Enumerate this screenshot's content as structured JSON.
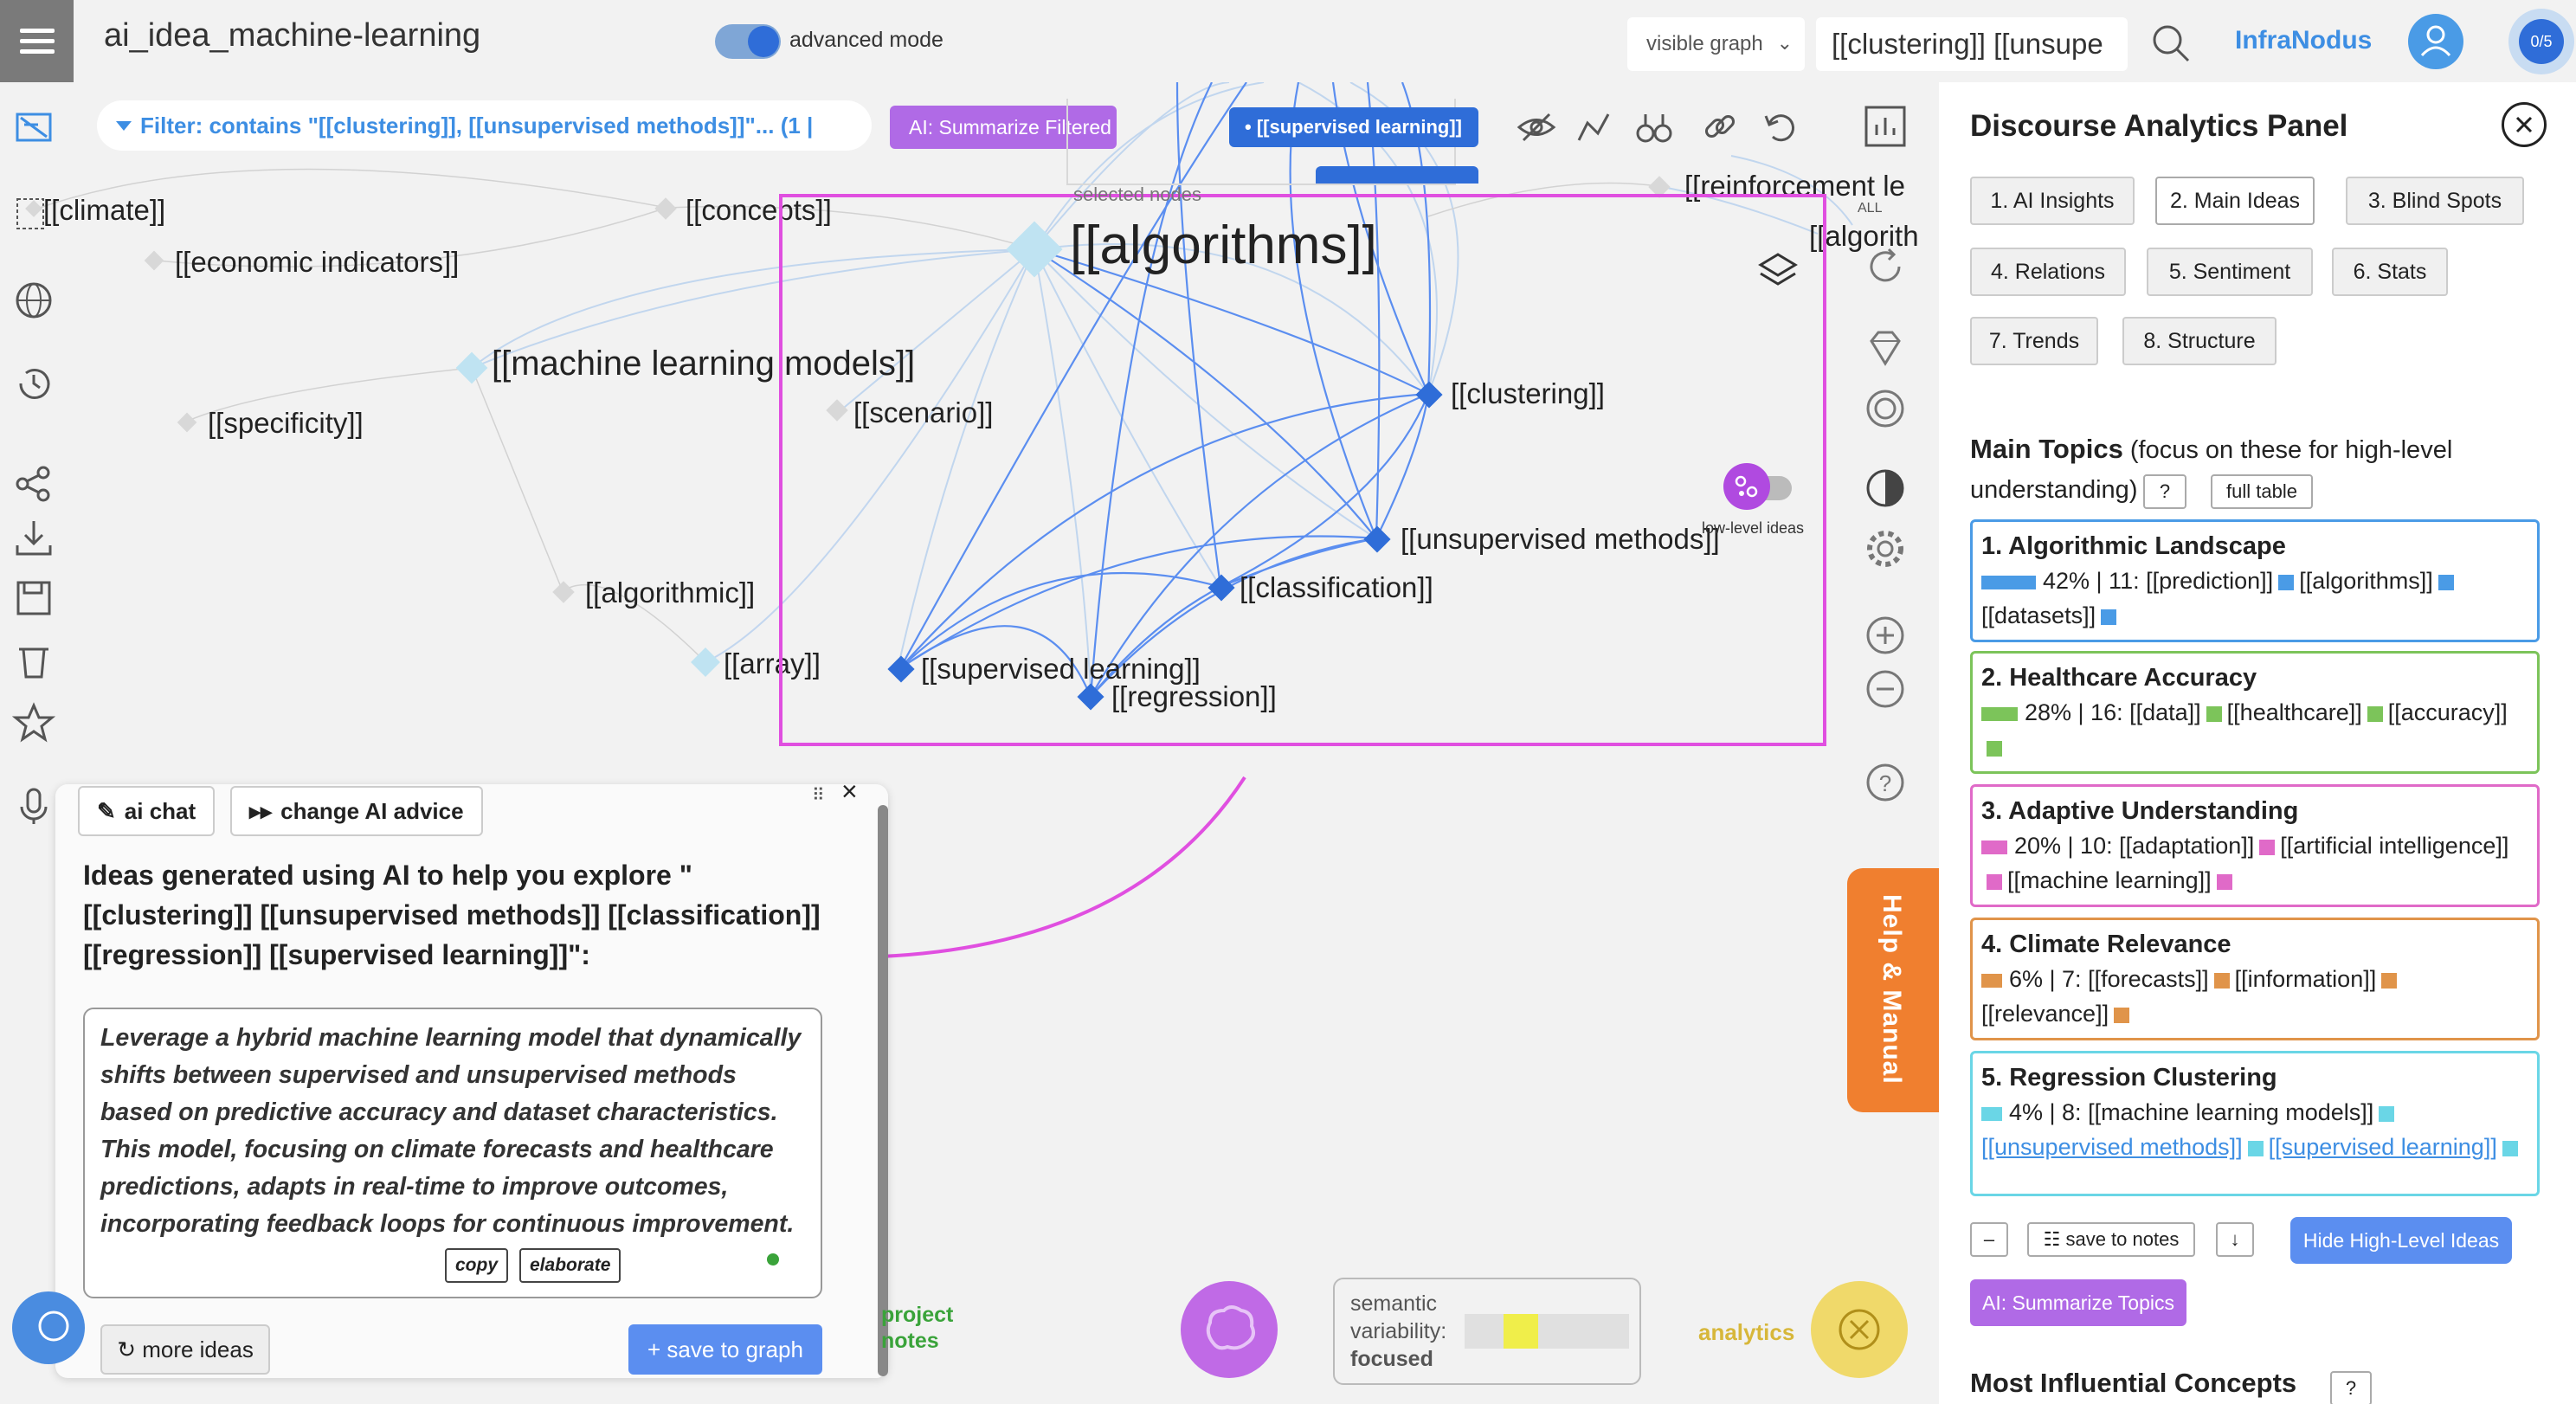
{
  "app": {
    "title": "ai_idea_machine-learning",
    "advanced_mode_label": "advanced mode",
    "visible_graph_select": "visible graph",
    "search_value": "[[clustering]] [[unsupe",
    "brand": "InfraNodus",
    "counter": "0/5"
  },
  "filter": {
    "text": "Filter: contains \"[[clustering]], [[unsupervised methods]]\"... (1 |",
    "ai_button": "AI: Summarize Filtered",
    "selected_nodes_label": "selected nodes",
    "selected_pill": "• [[supervised learning]]"
  },
  "graph": {
    "nodes": {
      "climate": "[[climate]]",
      "concepts": "[[concepts]]",
      "reinforcement": "[[reinforcement le",
      "algorithm_cut": "[[algorith",
      "economic": "[[economic indicators]]",
      "algorithms": "[[algorithms]]",
      "ml_models": "[[machine learning models]]",
      "specificity": "[[specificity]]",
      "scenario": "[[scenario]]",
      "clustering": "[[clustering]]",
      "unsupervised": "[[unsupervised methods]]",
      "classification": "[[classification]]",
      "algorithmic": "[[algorithmic]]",
      "array": "[[array]]",
      "supervised": "[[supervised learning]]",
      "regression": "[[regression]]"
    },
    "low_level_label": "low-level ideas",
    "all_label": "ALL",
    "help_tab": "Help & Manual"
  },
  "chat": {
    "ai_chat_btn": "ai chat",
    "change_advice_btn": "change AI advice",
    "heading": "Ideas generated using AI to help you explore \"[[clustering]] [[unsupervised methods]] [[classification]] [[regression]] [[supervised learning]]\":",
    "idea": "Leverage a hybrid machine learning model that dynamically shifts between supervised and unsupervised methods based on predictive accuracy and dataset characteristics. This model, focusing on climate forecasts and healthcare predictions, adapts in real-time to improve outcomes, incorporating feedback loops for continuous improvement.",
    "copy_btn": "copy",
    "elaborate_btn": "elaborate",
    "more_ideas_btn": "↻ more ideas",
    "save_graph_btn": "+ save to graph"
  },
  "bottom": {
    "project_notes": "project notes",
    "semantic_label_1": "semantic",
    "semantic_label_2": "variability:",
    "semantic_value": "focused",
    "semantic_level": 0.3,
    "analytics_label": "analytics"
  },
  "panel": {
    "title": "Discourse Analytics Panel",
    "tabs": [
      {
        "label": "1. AI Insights"
      },
      {
        "label": "2. Main Ideas",
        "active": true
      },
      {
        "label": "3. Blind Spots"
      },
      {
        "label": "4. Relations"
      },
      {
        "label": "5. Sentiment"
      },
      {
        "label": "6. Stats"
      },
      {
        "label": "7. Trends"
      },
      {
        "label": "8. Structure"
      }
    ],
    "main_topics_title": "Main Topics",
    "main_topics_sub": "(focus on these for high-level understanding)",
    "help_btn": "?",
    "full_table_btn": "full table",
    "topics": [
      {
        "title": "1. Algorithmic Landscape",
        "pct": "42% | 11:",
        "terms": [
          "[[prediction]]",
          "[[algorithms]]",
          "[[datasets]]"
        ],
        "color": "#4a9be6",
        "share": 0.42
      },
      {
        "title": "2. Healthcare Accuracy",
        "pct": "28% | 16:",
        "terms": [
          "[[data]]",
          "[[healthcare]]",
          "[[accuracy]]"
        ],
        "color": "#7cc45a",
        "share": 0.28
      },
      {
        "title": "3. Adaptive Understanding",
        "pct": "20% | 10:",
        "terms": [
          "[[adaptation]]",
          "[[artificial intelligence]]",
          "[[machine learning]]"
        ],
        "color": "#e06ac8",
        "share": 0.2
      },
      {
        "title": "4. Climate Relevance",
        "pct": "6% | 7:",
        "terms": [
          "[[forecasts]]",
          "[[information]]",
          "[[relevance]]"
        ],
        "color": "#e0944a",
        "share": 0.06
      },
      {
        "title": "5. Regression Clustering",
        "pct": "4% | 8:",
        "terms": [
          "[[machine learning models]]",
          "[[unsupervised methods]]",
          "[[supervised learning]]"
        ],
        "color": "#6ad6e6",
        "share": 0.04
      }
    ],
    "minus_btn": "–",
    "save_notes_btn": "☷ save to notes",
    "down_btn": "↓",
    "hide_btn": "Hide High-Level Ideas",
    "summarize_btn": "AI: Summarize Topics",
    "most_influential": "Most Influential Concepts",
    "most_influential_help": "?"
  },
  "colors": {
    "accent": "#3d8ee3",
    "node": "#2f6dd8",
    "selection": "#e04fe0",
    "help": "#f07f2f"
  }
}
